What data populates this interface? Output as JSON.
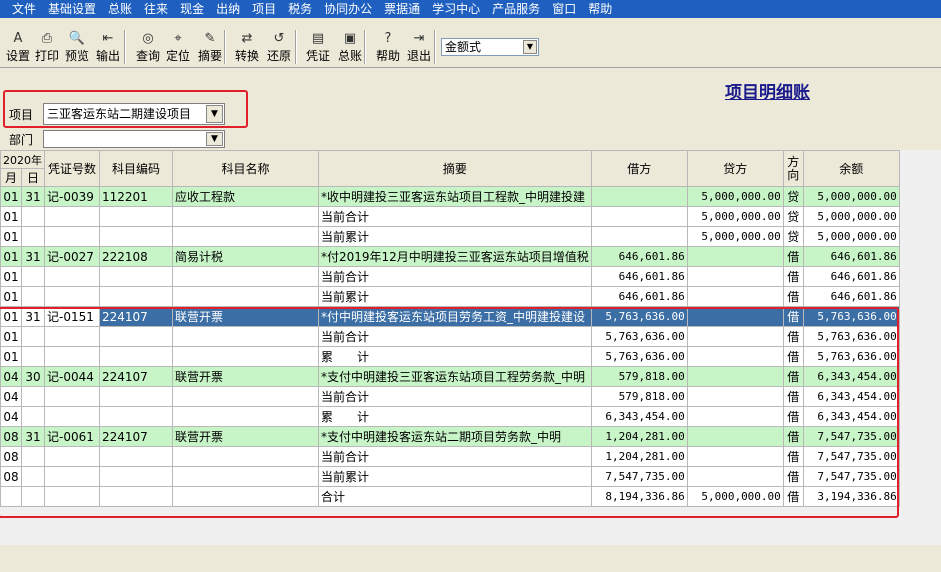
{
  "menu": [
    "文件",
    "基础设置",
    "总账",
    "往来",
    "现金",
    "出纳",
    "项目",
    "税务",
    "协同办公",
    "票据通",
    "学习中心",
    "产品服务",
    "窗口",
    "帮助"
  ],
  "toolbar": {
    "buttons": [
      {
        "label": "设置",
        "icon": "settings-icon"
      },
      {
        "label": "打印",
        "icon": "print-icon"
      },
      {
        "label": "预览",
        "icon": "preview-icon"
      },
      {
        "label": "输出",
        "icon": "export-icon"
      },
      {
        "label": "查询",
        "icon": "binoculars-icon"
      },
      {
        "label": "定位",
        "icon": "locate-icon"
      },
      {
        "label": "摘要",
        "icon": "summary-icon"
      },
      {
        "label": "转换",
        "icon": "convert-icon"
      },
      {
        "label": "还原",
        "icon": "restore-icon"
      },
      {
        "label": "凭证",
        "icon": "voucher-icon"
      },
      {
        "label": "总账",
        "icon": "ledger-icon"
      },
      {
        "label": "帮助",
        "icon": "help-icon"
      },
      {
        "label": "退出",
        "icon": "exit-icon"
      }
    ],
    "format_select": "金额式"
  },
  "page_title": "项目明细账",
  "filter": {
    "project_label": "项目",
    "project_value": "三亚客运东站二期建设项目",
    "dept_label": "部门",
    "dept_value": ""
  },
  "table": {
    "headers": {
      "year": "2020年",
      "month": "月",
      "day": "日",
      "voucher": "凭证号数",
      "code": "科目编码",
      "name": "科目名称",
      "summary": "摘要",
      "debit": "借方",
      "credit": "贷方",
      "direction": "方向",
      "balance": "余额"
    },
    "rows": [
      {
        "style": "green",
        "m": "01",
        "d": "31",
        "voucher": "记-0039",
        "code": "112201",
        "name": "应收工程款",
        "summary": "*收中明建投三亚客运东站项目工程款_中明建投建",
        "debit": "",
        "credit": "5,000,000.00",
        "dir": "贷",
        "balance": "5,000,000.00"
      },
      {
        "style": "white",
        "m": "01",
        "d": "",
        "voucher": "",
        "code": "",
        "name": "",
        "summary": "当前合计",
        "debit": "",
        "credit": "5,000,000.00",
        "dir": "贷",
        "balance": "5,000,000.00"
      },
      {
        "style": "white",
        "m": "01",
        "d": "",
        "voucher": "",
        "code": "",
        "name": "",
        "summary": "当前累计",
        "debit": "",
        "credit": "5,000,000.00",
        "dir": "贷",
        "balance": "5,000,000.00"
      },
      {
        "style": "green",
        "m": "01",
        "d": "31",
        "voucher": "记-0027",
        "code": "222108",
        "name": "简易计税",
        "summary": "*付2019年12月中明建投三亚客运东站项目增值税",
        "debit": "646,601.86",
        "credit": "",
        "dir": "借",
        "balance": "646,601.86"
      },
      {
        "style": "white",
        "m": "01",
        "d": "",
        "voucher": "",
        "code": "",
        "name": "",
        "summary": "当前合计",
        "debit": "646,601.86",
        "credit": "",
        "dir": "借",
        "balance": "646,601.86"
      },
      {
        "style": "white",
        "m": "01",
        "d": "",
        "voucher": "",
        "code": "",
        "name": "",
        "summary": "当前累计",
        "debit": "646,601.86",
        "credit": "",
        "dir": "借",
        "balance": "646,601.86"
      },
      {
        "style": "sel",
        "m": "01",
        "d": "31",
        "voucher": "记-0151",
        "code": "224107",
        "name": "联营开票",
        "summary": "*付中明建投客运东站项目劳务工资_中明建投建设",
        "debit": "5,763,636.00",
        "credit": "",
        "dir": "借",
        "balance": "5,763,636.00"
      },
      {
        "style": "white",
        "m": "01",
        "d": "",
        "voucher": "",
        "code": "",
        "name": "",
        "summary": "当前合计",
        "debit": "5,763,636.00",
        "credit": "",
        "dir": "借",
        "balance": "5,763,636.00"
      },
      {
        "style": "white",
        "m": "01",
        "d": "",
        "voucher": "",
        "code": "",
        "name": "",
        "summary": "累　　计",
        "debit": "5,763,636.00",
        "credit": "",
        "dir": "借",
        "balance": "5,763,636.00"
      },
      {
        "style": "green",
        "m": "04",
        "d": "30",
        "voucher": "记-0044",
        "code": "224107",
        "name": "联营开票",
        "summary": "*支付中明建投三亚客运东站项目工程劳务款_中明",
        "debit": "579,818.00",
        "credit": "",
        "dir": "借",
        "balance": "6,343,454.00"
      },
      {
        "style": "white",
        "m": "04",
        "d": "",
        "voucher": "",
        "code": "",
        "name": "",
        "summary": "当前合计",
        "debit": "579,818.00",
        "credit": "",
        "dir": "借",
        "balance": "6,343,454.00"
      },
      {
        "style": "white",
        "m": "04",
        "d": "",
        "voucher": "",
        "code": "",
        "name": "",
        "summary": "累　　计",
        "debit": "6,343,454.00",
        "credit": "",
        "dir": "借",
        "balance": "6,343,454.00"
      },
      {
        "style": "green",
        "m": "08",
        "d": "31",
        "voucher": "记-0061",
        "code": "224107",
        "name": "联营开票",
        "summary": "*支付中明建投客运东站二期项目劳务款_中明",
        "debit": "1,204,281.00",
        "credit": "",
        "dir": "借",
        "balance": "7,547,735.00"
      },
      {
        "style": "white",
        "m": "08",
        "d": "",
        "voucher": "",
        "code": "",
        "name": "",
        "summary": "当前合计",
        "debit": "1,204,281.00",
        "credit": "",
        "dir": "借",
        "balance": "7,547,735.00"
      },
      {
        "style": "white",
        "m": "08",
        "d": "",
        "voucher": "",
        "code": "",
        "name": "",
        "summary": "当前累计",
        "debit": "7,547,735.00",
        "credit": "",
        "dir": "借",
        "balance": "7,547,735.00"
      },
      {
        "style": "white",
        "m": "",
        "d": "",
        "voucher": "",
        "code": "",
        "name": "",
        "summary": "合计",
        "debit": "8,194,336.86",
        "credit": "5,000,000.00",
        "dir": "借",
        "balance": "3,194,336.86"
      }
    ]
  },
  "colors": {
    "menubar": "#1e5fbf",
    "row_green": "#c8f5c8",
    "selection": "#3a6ea5",
    "highlight_red": "#e0202a",
    "title": "#1a1a8c"
  }
}
